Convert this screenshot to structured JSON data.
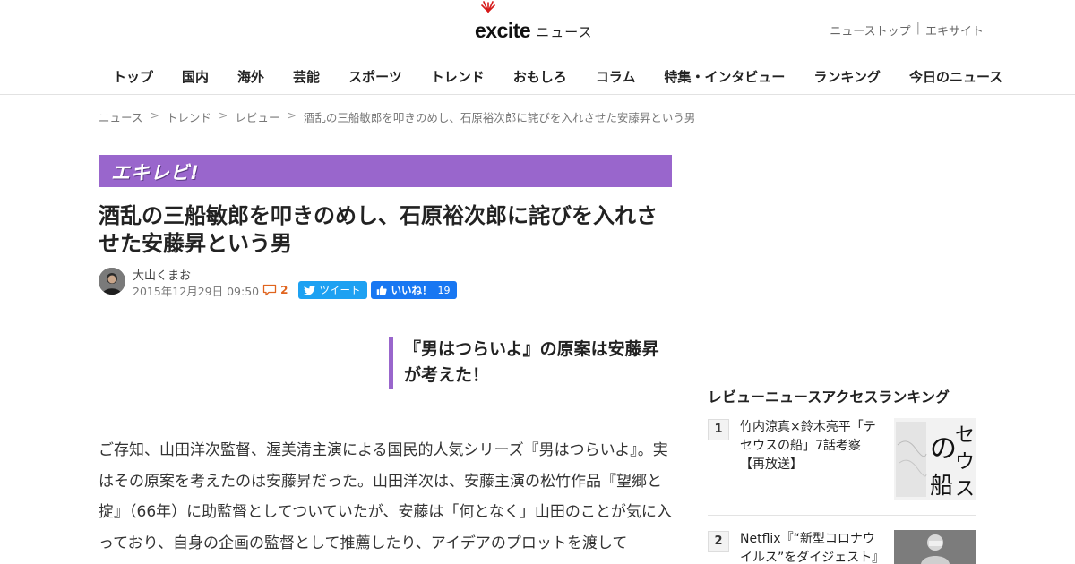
{
  "header": {
    "logo_word": "excite",
    "logo_sub": "ニュース",
    "links": [
      "ニューストップ",
      "エキサイト"
    ],
    "link_sep": "|",
    "nav": [
      "トップ",
      "国内",
      "海外",
      "芸能",
      "スポーツ",
      "トレンド",
      "おもしろ",
      "コラム",
      "特集・インタビュー",
      "ランキング",
      "今日のニュース"
    ]
  },
  "breadcrumb": {
    "items": [
      "ニュース",
      "トレンド",
      "レビュー",
      "酒乱の三船敏郎を叩きのめし、石原裕次郎に詫びを入れさせた安藤昇という男"
    ],
    "arrow": ">"
  },
  "article": {
    "banner": "エキレビ!",
    "title": "酒乱の三船敏郎を叩きのめし、石原裕次郎に詫びを入れさせた安藤昇という男",
    "author": "大山くまお",
    "date": "2015年12月29日 09:50",
    "comment_count": "2",
    "tweet_label": "ツイート",
    "like_label": "いいね！",
    "like_count": "19",
    "pullquote": "『男はつらいよ』の原案は安藤昇が考えた！",
    "body": "ご存知、山田洋次監督、渥美清主演による国民的人気シリーズ『男はつらいよ』。実はその原案を考えたのは安藤昇だった。山田洋次は、安藤主演の松竹作品『望郷と掟』（66年）に助監督としてついていたが、安藤は「何となく」山田のことが気に入っており、自身の企画の監督として推薦したり、アイデアのプロットを渡して"
  },
  "sidebar": {
    "heading": "レビューニュースアクセスランキング",
    "ranking": [
      {
        "rank": "1",
        "title": "竹内涼真×鈴木亮平「テセウスの船」7話考察【再放送】",
        "thumb_text": "セウスの船"
      },
      {
        "rank": "2",
        "title": "Netflix『“新型コロナウイルス”をダイジェスト』"
      }
    ]
  },
  "colors": {
    "accent": "#9966cc",
    "twitter": "#1da1f2",
    "facebook": "#1877f2",
    "comment": "#e0641e"
  }
}
